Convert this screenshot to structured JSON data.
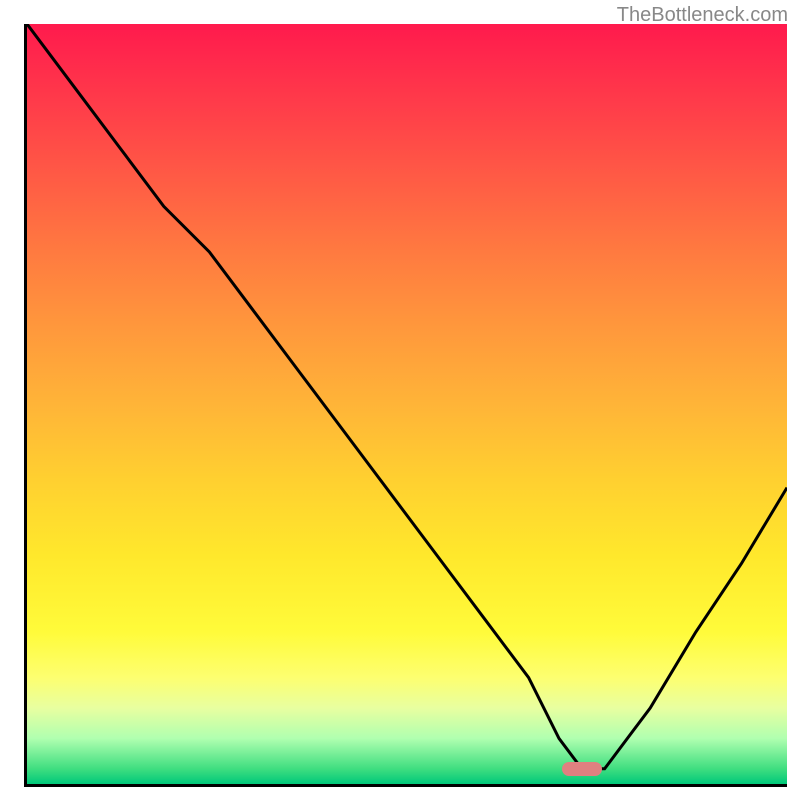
{
  "watermark": "TheBottleneck.com",
  "chart_data": {
    "type": "line",
    "title": "",
    "xlabel": "",
    "ylabel": "",
    "xlim": [
      0,
      100
    ],
    "ylim": [
      0,
      100
    ],
    "grid": false,
    "legend": false,
    "annotations": [
      "Background is a vertical gradient from red (top) through orange/yellow to green (bottom). V-shaped black curve with minimum near x≈73. Small pink marker at the curve minimum on the green band."
    ],
    "series": [
      {
        "name": "bottleneck-curve",
        "color": "#000000",
        "x": [
          0,
          6,
          12,
          18,
          24,
          30,
          36,
          42,
          48,
          54,
          60,
          66,
          70,
          73,
          76,
          82,
          88,
          94,
          100
        ],
        "values": [
          100,
          92,
          84,
          76,
          70,
          62,
          54,
          46,
          38,
          30,
          22,
          14,
          6,
          2,
          2,
          10,
          20,
          29,
          39
        ]
      }
    ],
    "marker": {
      "color": "#e08080",
      "x": 73,
      "y": 2
    },
    "gradient_colors": {
      "top": "#ff1a4d",
      "middle": "#ffe82c",
      "bottom": "#00c87a"
    }
  }
}
